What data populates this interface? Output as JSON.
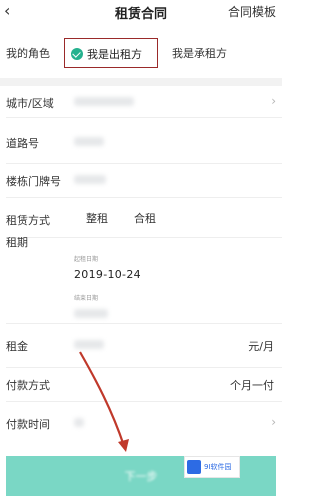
{
  "header": {
    "back_icon": "‹",
    "title": "租赁合同",
    "template_label": "合同模板"
  },
  "role": {
    "label": "我的角色",
    "landlord_label": "我是出租方",
    "tenant_label": "我是承租方"
  },
  "fields": {
    "city_label": "城市/区域",
    "road_label": "道路号",
    "building_label": "楼栋门牌号",
    "rent_type_label": "租赁方式",
    "rent_type_options": [
      "整租",
      "合租"
    ],
    "period_label": "租期",
    "start_caption": "起租日期",
    "start_date": "2019-10-24",
    "end_caption": "结束日期",
    "rent_label": "租金",
    "rent_unit": "元/月",
    "payment_label": "付款方式",
    "payment_value": "个月一付",
    "payment_time_label": "付款时间"
  },
  "footer": {
    "next_label": "下一步",
    "watermark_badge": "9",
    "watermark_text": "9I软件园"
  },
  "colors": {
    "accent": "#25b18e",
    "button": "#7ad7c5",
    "annotation": "#c0392b"
  }
}
